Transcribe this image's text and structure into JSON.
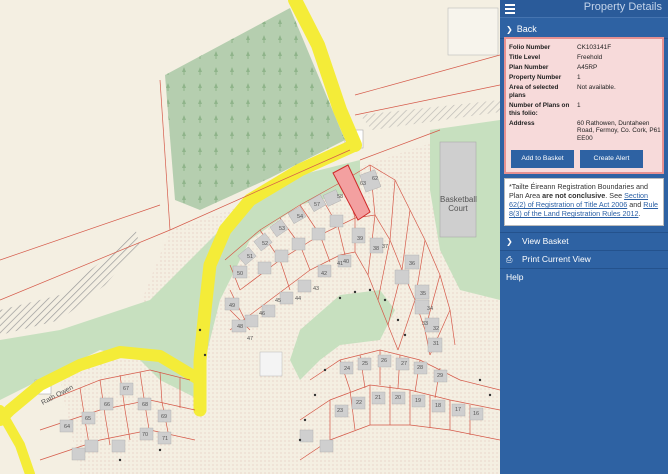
{
  "header": {
    "title": "Property Details",
    "menu_icon": "hamburger-icon"
  },
  "back": {
    "label": "Back",
    "icon": "chevron-right-icon"
  },
  "details": {
    "rows": [
      {
        "key": "Folio Number",
        "value": "CK103141F"
      },
      {
        "key": "Title Level",
        "value": "Freehold"
      },
      {
        "key": "Plan Number",
        "value": "A45RP"
      },
      {
        "key": "Property Number",
        "value": "1"
      },
      {
        "key": "Area of selected plans",
        "value": "Not available."
      },
      {
        "key": "Number of Plans on this folio:",
        "value": "1"
      },
      {
        "key": "Address",
        "value": "60 Rathowen, Duntaheen Road, Fermoy, Co. Cork, P61 EE00"
      }
    ],
    "add_to_basket": "Add to Basket",
    "create_alert": "Create Alert",
    "highlight_border": "#e79191",
    "highlight_bg": "#f7dada"
  },
  "disclaimer": {
    "prefix": "*Tailte Éireann Registration Boundaries and Plan Area ",
    "bold": "are not conclusive",
    "mid": ". See ",
    "link1": "Section 62(2) of Registration of Title Act 2006",
    "and": " and ",
    "link2": "Rule 8(3) of the Land Registration Rules 2012",
    "suffix": "."
  },
  "menu": [
    {
      "label": "View Basket",
      "icon": "chevron-right-icon"
    },
    {
      "label": "Print Current View",
      "icon": "printer-icon"
    },
    {
      "label": "Help",
      "icon": ""
    }
  ],
  "map": {
    "labels": {
      "court": "Basketball Court",
      "road": "Rath Owen"
    },
    "plot_numbers": [
      "62",
      "63",
      "58",
      "57",
      "54",
      "53",
      "52",
      "51",
      "50",
      "49",
      "48",
      "47",
      "46",
      "45",
      "44",
      "43",
      "42",
      "41",
      "40",
      "39",
      "38",
      "37",
      "36",
      "35",
      "34",
      "33",
      "32",
      "31",
      "30",
      "29",
      "28",
      "27",
      "26",
      "25",
      "24",
      "23",
      "22",
      "21",
      "20",
      "19",
      "18",
      "17",
      "16",
      "15",
      "14",
      "13",
      "12",
      "11",
      "10",
      "9",
      "8",
      "7",
      "6",
      "5",
      "4",
      "3",
      "2",
      "1",
      "64",
      "65",
      "66",
      "67",
      "68",
      "69",
      "70",
      "71"
    ],
    "colors": {
      "background": "#f4efe2",
      "road": "#f4ec38",
      "green": "#c4dfbe",
      "forest": "#b2ccae",
      "building": "#cfcfcf",
      "boundary": "#d55a4a",
      "selected": "#f3a0a0",
      "panel": "#2e62a3"
    }
  }
}
